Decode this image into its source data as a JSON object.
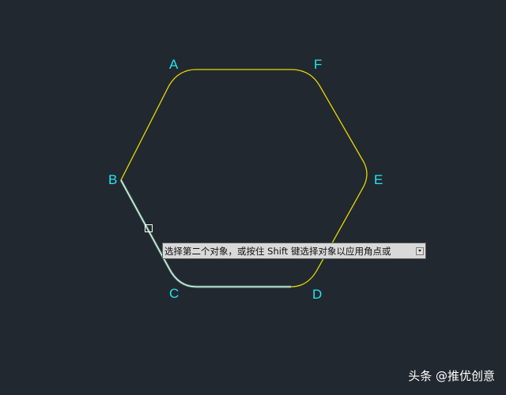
{
  "vertices": {
    "A": "A",
    "B": "B",
    "C": "C",
    "D": "D",
    "E": "E",
    "F": "F"
  },
  "tooltip": {
    "text": "选择第二个对象，或按住 Shift 键选择对象以应用角点或"
  },
  "watermark": "头条 @推优创意",
  "colors": {
    "background": "#222830",
    "hexagon": "#e5d800",
    "selected": "#7fd0c8",
    "label": "#22e6f0"
  }
}
